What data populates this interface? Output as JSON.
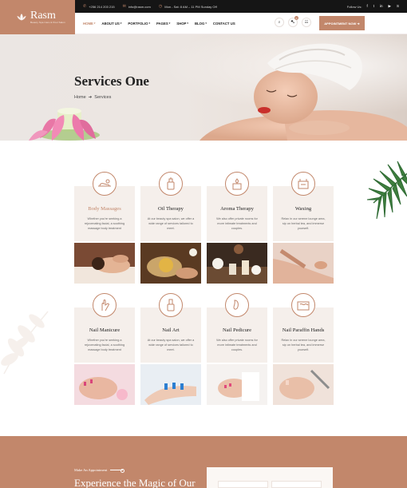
{
  "brand": {
    "name": "Rasm",
    "tagline": "Beauty Spa Care & Pool Salon"
  },
  "topbar": {
    "phone": "+256 214 203 215",
    "email": "info@rasm.com",
    "hours": "Mon - Sat: 8 AM – 11 PM Sunday Off",
    "follow_label": "Follow Us:",
    "socials": [
      "facebook-icon",
      "twitter-icon",
      "linkedin-icon",
      "youtube-icon",
      "skype-icon"
    ]
  },
  "nav": {
    "items": [
      {
        "label": "HOME",
        "active": true
      },
      {
        "label": "ABOUT US"
      },
      {
        "label": "PORTFOLIO"
      },
      {
        "label": "PAGES"
      },
      {
        "label": "SHOP"
      },
      {
        "label": "BLOG"
      },
      {
        "label": "CONTACT US"
      }
    ],
    "cart_count": "0",
    "cta": "APPOINTMENT NOW ➜"
  },
  "hero": {
    "title": "Services One",
    "breadcrumb": {
      "home": "Home",
      "current": "Services"
    }
  },
  "services": [
    {
      "name": "Body Massages",
      "desc": "Whether you're seeking a rejuvenating facial, a soothing massage body treatment",
      "highlight": true
    },
    {
      "name": "Oil Therapy",
      "desc": "At our beauty spa salon, we offer a wide range of services tailored to meet."
    },
    {
      "name": "Aroma Therapy",
      "desc": "We also offer private rooms for more intimate treatments and couples."
    },
    {
      "name": "Waxing",
      "desc": "Relax in our serene lounge area, sip on herbal tea, and immerse yourself."
    },
    {
      "name": "Nail Manicure",
      "desc": "Whether you're seeking a rejuvenating facial, a soothing massage body treatment"
    },
    {
      "name": "Nail Art",
      "desc": "At our beauty spa salon, we offer a wide range of services tailored to meet."
    },
    {
      "name": "Nail Pedicure",
      "desc": "We also offer private rooms for more intimate treatments and couples."
    },
    {
      "name": "Nail Paraffin Hands",
      "desc": "Relax in our serene lounge area, sip on herbal tea, and immerse yourself."
    }
  ],
  "appointment": {
    "kicker": "Make An Appointment",
    "heading": "Experience the Magic of Our"
  },
  "colors": {
    "accent": "#c2876b",
    "topbar": "#151515",
    "card_bg": "#f5efeb"
  }
}
